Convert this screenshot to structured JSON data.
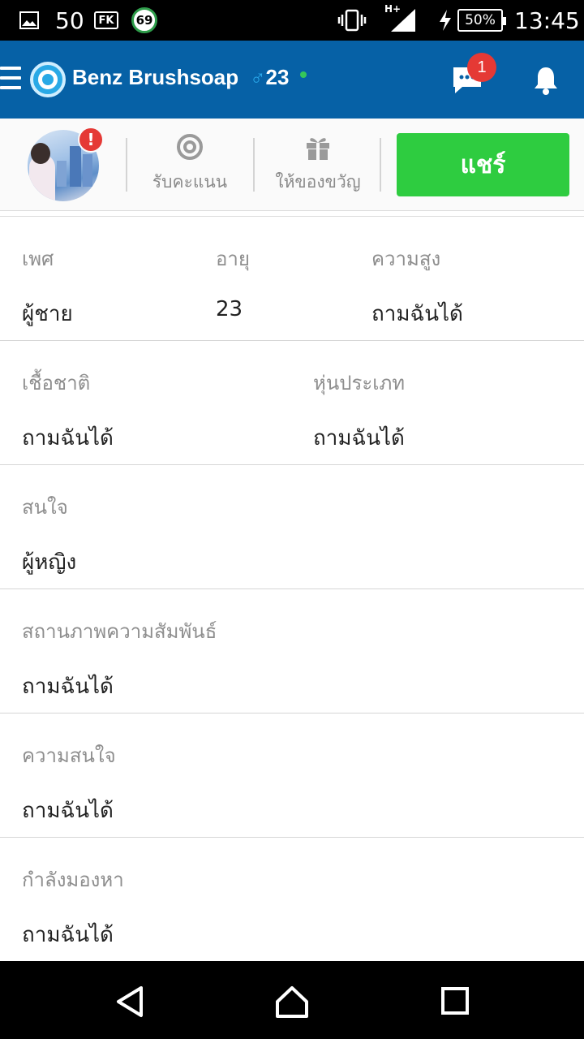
{
  "status_bar": {
    "signal_number": "50",
    "fk_label": "FK",
    "badge_number": "69",
    "network": "H+",
    "battery": "50%",
    "time": "13:45",
    "icons": [
      "image-icon",
      "vibrate-icon",
      "signal-icon",
      "charging-icon",
      "battery-icon"
    ]
  },
  "app_bar": {
    "title": "Benz Brushsoap",
    "gender_symbol": "♂",
    "age": "23",
    "chat_badge": "1",
    "colors": {
      "background": "#0661a6",
      "online": "#35c75a",
      "badge": "#e53935"
    }
  },
  "actions": {
    "alert_badge": "!",
    "get_points": "รับคะแนน",
    "give_gift": "ให้ของขวัญ",
    "share": "แชร์",
    "share_color": "#2ecc40"
  },
  "profile": {
    "row1": [
      {
        "label": "เพศ",
        "value": "ผู้ชาย"
      },
      {
        "label": "อายุ",
        "value": "23"
      },
      {
        "label": "ความสูง",
        "value": "ถามฉันได้"
      }
    ],
    "row2": [
      {
        "label": "เชื้อชาติ",
        "value": "ถามฉันได้"
      },
      {
        "label": "หุ่นประเภท",
        "value": "ถามฉันได้"
      }
    ],
    "interested_in": {
      "label": "สนใจ",
      "value": "ผู้หญิง"
    },
    "relationship": {
      "label": "สถานภาพความสัมพันธ์",
      "value": "ถามฉันได้"
    },
    "interests": {
      "label": "ความสนใจ",
      "value": "ถามฉันได้"
    },
    "looking_for": {
      "label": "กำลังมองหา",
      "value": "ถามฉันได้"
    }
  },
  "nav": {
    "icons": [
      "back-icon",
      "home-icon",
      "recents-icon"
    ]
  }
}
